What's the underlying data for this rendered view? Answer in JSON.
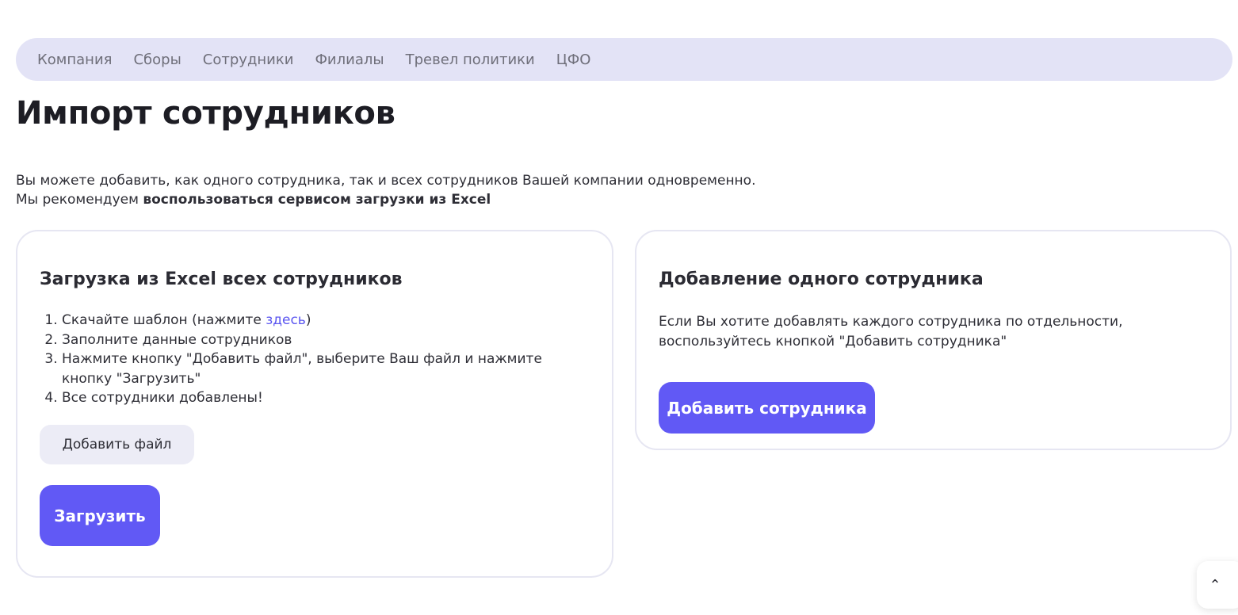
{
  "nav": {
    "items": [
      {
        "label": "Компания"
      },
      {
        "label": "Сборы"
      },
      {
        "label": "Сотрудники"
      },
      {
        "label": "Филиалы"
      },
      {
        "label": "Тревел политики"
      },
      {
        "label": "ЦФО"
      }
    ]
  },
  "page": {
    "title": "Импорт сотрудников",
    "intro_line1": "Вы можете добавить, как одного сотрудника, так и всех сотрудников Вашей компании одновременно.",
    "intro_line2_prefix": "Мы рекомендуем ",
    "intro_line2_strong": "воспользоваться сервисом загрузки из Excel"
  },
  "excel_card": {
    "title": "Загрузка из Excel всех сотрудников",
    "step1_prefix": "Скачайте шаблон (нажмите ",
    "step1_link": "здесь",
    "step1_suffix": ")",
    "step2": "Заполните данные сотрудников",
    "step3": "Нажмите кнопку \"Добавить файл\", выберите Ваш файл и нажмите кнопку \"Загрузить\"",
    "step4": "Все сотрудники добавлены!",
    "add_file_label": "Добавить файл",
    "upload_label": "Загрузить"
  },
  "single_card": {
    "title": "Добавление одного сотрудника",
    "text_line1": "Если Вы хотите добавлять каждого сотрудника по отдельности,",
    "text_line2": "воспользуйтесь кнопкой \"Добавить сотрудника\"",
    "add_employee_label": "Добавить сотрудника"
  },
  "scroll_top": {
    "icon": "chevron-up-icon",
    "glyph": "⌃"
  },
  "colors": {
    "accent": "#6159f5",
    "nav_bg": "#e3e3f6",
    "link": "#5b56f0",
    "light_button": "#ececf6"
  }
}
